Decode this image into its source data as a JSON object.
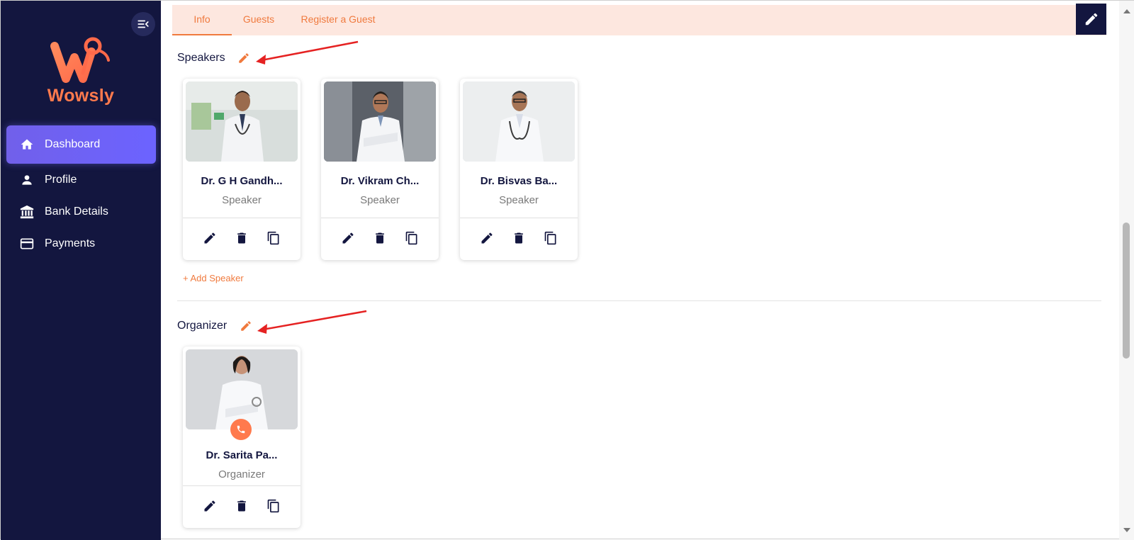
{
  "brand": {
    "name": "Wowsly",
    "accent": "#ff7a4d",
    "sidebar_bg": "#13163f"
  },
  "sidebar": {
    "items": [
      {
        "label": "Dashboard",
        "icon": "home-icon",
        "active": true
      },
      {
        "label": "Profile",
        "icon": "person-icon",
        "active": false
      },
      {
        "label": "Bank Details",
        "icon": "bank-icon",
        "active": false
      },
      {
        "label": "Payments",
        "icon": "credit-card-icon",
        "active": false
      }
    ]
  },
  "tabs": [
    {
      "label": "Info",
      "active": true
    },
    {
      "label": "Guests",
      "active": false
    },
    {
      "label": "Register a Guest",
      "active": false
    }
  ],
  "speakers": {
    "title": "Speakers",
    "add_label": "+ Add Speaker",
    "cards": [
      {
        "name": "Dr. G H Gandh...",
        "role": "Speaker"
      },
      {
        "name": "Dr. Vikram Ch...",
        "role": "Speaker"
      },
      {
        "name": "Dr. Bisvas Ba...",
        "role": "Speaker"
      }
    ]
  },
  "organizer": {
    "title": "Organizer",
    "cards": [
      {
        "name": "Dr. Sarita Pa...",
        "role": "Organizer"
      }
    ]
  }
}
